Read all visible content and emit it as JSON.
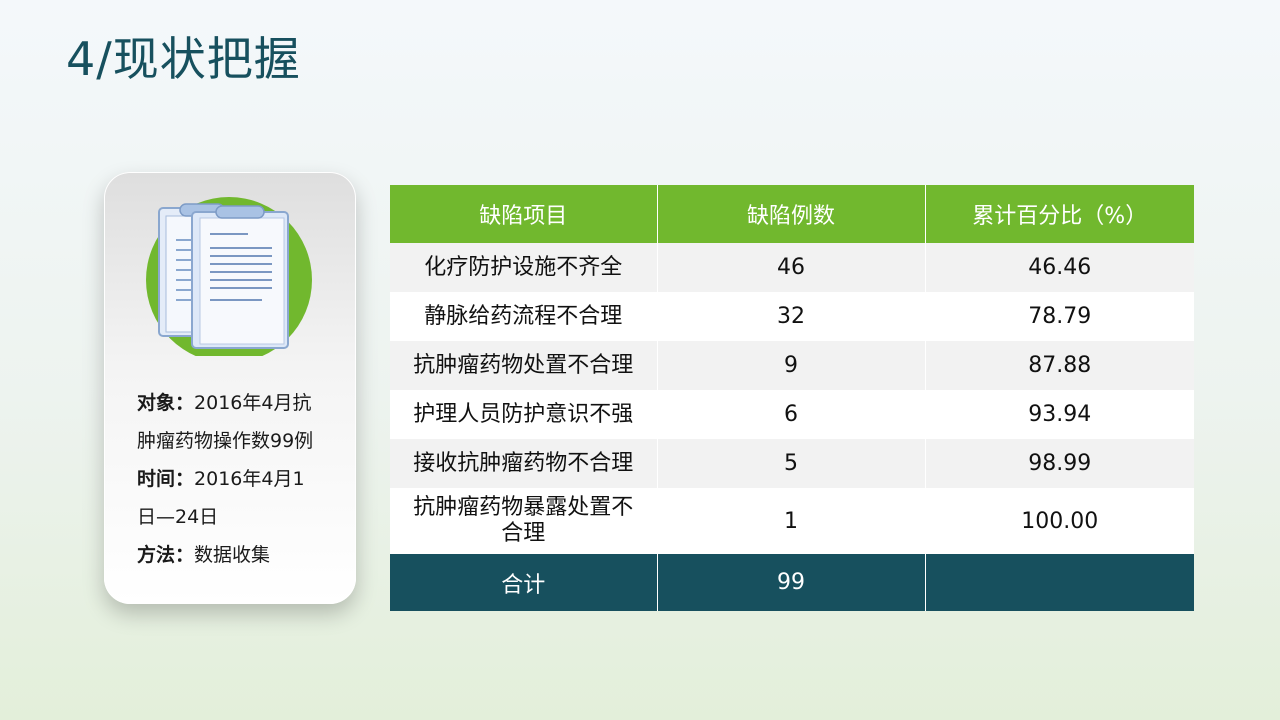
{
  "page": {
    "title": "4/现状把握"
  },
  "info_card": {
    "object_label": "对象：",
    "object_value_line1": "2016年4月抗",
    "object_value_line2": "肿瘤药物操作数99例",
    "time_label": "时间：",
    "time_value_line1": "2016年4月1",
    "time_value_line2": "日—24日",
    "method_label": "方法：",
    "method_value": "数据收集",
    "icon": "clipboard-document-icon",
    "colors": {
      "circle": "#71b82e",
      "page_fill": "#e9f0fb",
      "page_outline": "#8aa7cf"
    }
  },
  "table": {
    "headers": [
      "缺陷项目",
      "缺陷例数",
      "累计百分比（%）"
    ],
    "rows": [
      {
        "item": "化疗防护设施不齐全",
        "count": "46",
        "cumulative": "46.46"
      },
      {
        "item": "静脉给药流程不合理",
        "count": "32",
        "cumulative": "78.79"
      },
      {
        "item": "抗肿瘤药物处置不合理",
        "count": "9",
        "cumulative": "87.88"
      },
      {
        "item": "护理人员防护意识不强",
        "count": "6",
        "cumulative": "93.94"
      },
      {
        "item": "接收抗肿瘤药物不合理",
        "count": "5",
        "cumulative": "98.99"
      },
      {
        "item_line1": "抗肿瘤药物暴露处置不",
        "item_line2": "合理",
        "count": "1",
        "cumulative": "100.00"
      }
    ],
    "total": {
      "label": "合计",
      "count": "99",
      "cumulative": ""
    },
    "colors": {
      "header_bg": "#71b82e",
      "total_bg": "#17505e",
      "row_alt_bg": "#f2f2f2"
    }
  }
}
